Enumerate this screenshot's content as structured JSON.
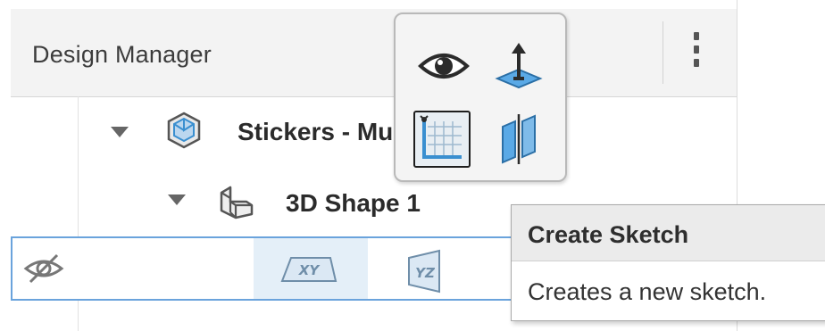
{
  "panel": {
    "title": "Design Manager",
    "menu_icon": "kebab-menu-icon"
  },
  "tree": {
    "items": [
      {
        "label": "Stickers - Multi-Layered",
        "icon": "component-icon",
        "expanded": true
      },
      {
        "label": "3D Shape 1",
        "icon": "solid-body-icon",
        "expanded": true
      }
    ],
    "selected_row": {
      "visibility_icon": "eye-hidden-icon",
      "planes": [
        {
          "label": "XY",
          "icon": "plane-xy-icon"
        },
        {
          "label": "YZ",
          "icon": "plane-yz-icon"
        }
      ]
    }
  },
  "popup": {
    "buttons": [
      {
        "icon": "eye-icon"
      },
      {
        "icon": "move-plane-icon"
      },
      {
        "icon": "create-sketch-icon"
      },
      {
        "icon": "section-view-icon"
      }
    ]
  },
  "tooltip": {
    "title": "Create Sketch",
    "description": "Creates a new sketch."
  },
  "colors": {
    "header_bg": "#f3f3f3",
    "selection_border": "#6aa3dc",
    "selection_fill": "#e4eff8",
    "icon_blue": "#3a8fd0"
  }
}
